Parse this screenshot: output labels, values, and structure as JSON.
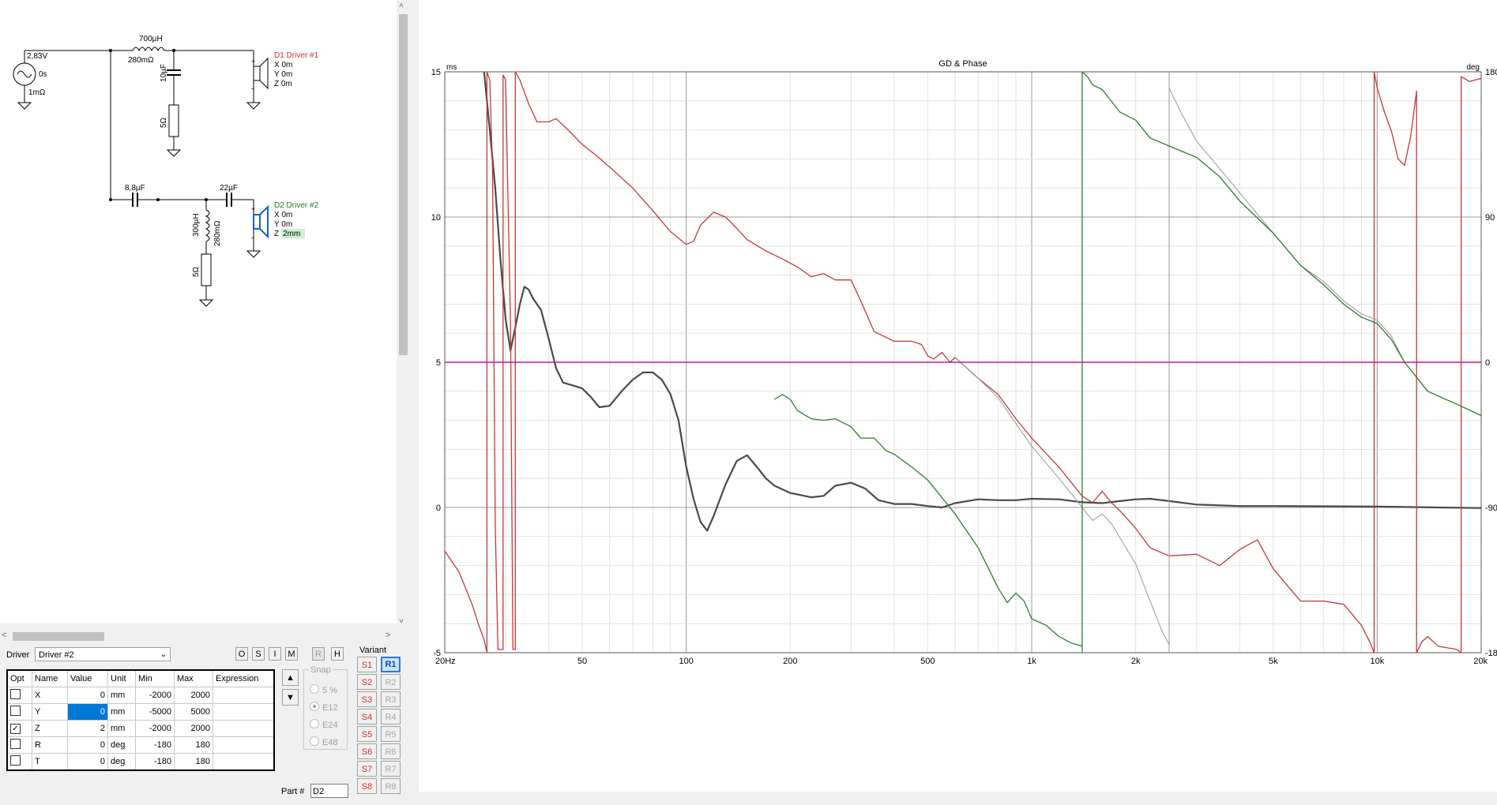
{
  "schematic": {
    "source": {
      "voltage": "2,83V",
      "delay": "0s",
      "resistance": "1mΩ"
    },
    "l1": {
      "value": "700µH",
      "esr": "280mΩ"
    },
    "c1": {
      "value": "10µF"
    },
    "r1": {
      "value": "5Ω"
    },
    "d1": {
      "name": "D1 Driver #1",
      "x": "X 0m",
      "y": "Y 0m",
      "z": "Z 0m"
    },
    "c2": {
      "value": "8,8µF"
    },
    "c3": {
      "value": "22µF"
    },
    "l2": {
      "value": "300µH",
      "esr": "280mΩ"
    },
    "r2": {
      "value": "5Ω"
    },
    "d2": {
      "name": "D2 Driver #2",
      "x": "X 0m",
      "y": "Y 0m",
      "z_prefix": "Z",
      "z_value": "2mm"
    },
    "colors": {
      "d1": "#d32f2f",
      "d2": "#1e7a1e",
      "d2_icon": "#1565c0"
    }
  },
  "scroll": {
    "up": "˄",
    "down": "˅",
    "left": "<",
    "right": ">"
  },
  "driver": {
    "label": "Driver",
    "selected": "Driver #2",
    "chevron": "⌄"
  },
  "toggles": [
    "O",
    "S",
    "I",
    "M",
    "R",
    "H"
  ],
  "table": {
    "headers": [
      "Opt",
      "Name",
      "Value",
      "Unit",
      "Min",
      "Max",
      "Expression"
    ],
    "rows": [
      {
        "opt": "",
        "name": "X",
        "value": "0",
        "unit": "mm",
        "min": "-2000",
        "max": "2000",
        "expr": ""
      },
      {
        "opt": "",
        "name": "Y",
        "value": "0",
        "unit": "mm",
        "min": "-5000",
        "max": "5000",
        "expr": ""
      },
      {
        "opt": "✓",
        "name": "Z",
        "value": "2",
        "unit": "mm",
        "min": "-2000",
        "max": "2000",
        "expr": ""
      },
      {
        "opt": "",
        "name": "R",
        "value": "0",
        "unit": "deg",
        "min": "-180",
        "max": "180",
        "expr": ""
      },
      {
        "opt": "",
        "name": "T",
        "value": "0",
        "unit": "deg",
        "min": "-180",
        "max": "180",
        "expr": ""
      }
    ]
  },
  "updown": {
    "up": "▲",
    "down": "▼"
  },
  "snap": {
    "title": "Snap",
    "options": [
      "5 %",
      "E12",
      "E24",
      "E48"
    ],
    "selected": "E12"
  },
  "part": {
    "label": "Part #",
    "value": "D2"
  },
  "variant": {
    "label": "Variant",
    "s": [
      "S1",
      "S2",
      "S3",
      "S4",
      "S5",
      "S6",
      "S7",
      "S8"
    ],
    "r": [
      "R1",
      "R2",
      "R3",
      "R4",
      "R5",
      "R6",
      "R7",
      "R8"
    ],
    "selected": "R1"
  },
  "chart_data": {
    "type": "line",
    "title": "GD & Phase",
    "ylabel": "ms",
    "y2label": "deg",
    "xscale": "log",
    "xlim": [
      20,
      20000
    ],
    "ylim": [
      -5,
      15
    ],
    "y2lim": [
      -180,
      180
    ],
    "xticks": [
      20,
      50,
      100,
      200,
      500,
      1000,
      2000,
      5000,
      10000,
      20000
    ],
    "xtick_labels": [
      "20Hz",
      "50",
      "100",
      "200",
      "500",
      "1k",
      "2k",
      "5k",
      "10k",
      "20k"
    ],
    "yticks": [
      -5,
      0,
      5,
      10,
      15
    ],
    "ytick_labels": [
      "-5",
      "0",
      "5",
      "10",
      "15"
    ],
    "y2ticks": [
      -180,
      -90,
      0,
      90,
      180
    ],
    "y2tick_labels": [
      "-180",
      "-90",
      "0",
      "90",
      "180"
    ],
    "grid": true,
    "colors": {
      "gd": "#4a4a4a",
      "phase_red": "#c0393b",
      "phase_green": "#2e7d32",
      "phase_gray": "#9e9e9e",
      "zero": "#c2188b"
    },
    "series": [
      {
        "axis": "left",
        "color": "#4a4a4a",
        "width": 2.2,
        "points": [
          [
            26,
            15
          ],
          [
            27,
            13
          ],
          [
            28,
            11
          ],
          [
            29,
            8.5
          ],
          [
            30,
            6.5
          ],
          [
            31,
            5.4
          ],
          [
            32,
            6.2
          ],
          [
            33,
            7.0
          ],
          [
            34,
            7.6
          ],
          [
            35,
            7.5
          ],
          [
            36,
            7.2
          ],
          [
            38,
            6.8
          ],
          [
            40,
            5.8
          ],
          [
            42,
            4.8
          ],
          [
            44,
            4.3
          ],
          [
            47,
            4.2
          ],
          [
            50,
            4.1
          ],
          [
            53,
            3.8
          ],
          [
            56,
            3.45
          ],
          [
            60,
            3.5
          ],
          [
            65,
            4.0
          ],
          [
            70,
            4.4
          ],
          [
            75,
            4.65
          ],
          [
            80,
            4.65
          ],
          [
            85,
            4.4
          ],
          [
            90,
            3.9
          ],
          [
            95,
            3.0
          ],
          [
            100,
            1.4
          ],
          [
            105,
            0.3
          ],
          [
            110,
            -0.5
          ],
          [
            115,
            -0.8
          ],
          [
            120,
            -0.3
          ],
          [
            130,
            0.8
          ],
          [
            140,
            1.6
          ],
          [
            150,
            1.8
          ],
          [
            160,
            1.4
          ],
          [
            170,
            1.0
          ],
          [
            180,
            0.75
          ],
          [
            200,
            0.5
          ],
          [
            230,
            0.35
          ],
          [
            250,
            0.4
          ],
          [
            270,
            0.75
          ],
          [
            300,
            0.85
          ],
          [
            330,
            0.65
          ],
          [
            360,
            0.25
          ],
          [
            400,
            0.12
          ],
          [
            450,
            0.12
          ],
          [
            500,
            0.05
          ],
          [
            550,
            0.0
          ],
          [
            600,
            0.15
          ],
          [
            700,
            0.28
          ],
          [
            800,
            0.25
          ],
          [
            900,
            0.25
          ],
          [
            1000,
            0.3
          ],
          [
            1200,
            0.28
          ],
          [
            1400,
            0.18
          ],
          [
            1600,
            0.15
          ],
          [
            1800,
            0.22
          ],
          [
            2000,
            0.28
          ],
          [
            2200,
            0.3
          ],
          [
            2500,
            0.22
          ],
          [
            3000,
            0.1
          ],
          [
            4000,
            0.05
          ],
          [
            5000,
            0.05
          ],
          [
            7000,
            0.04
          ],
          [
            10000,
            0.03
          ],
          [
            15000,
            0.0
          ],
          [
            20000,
            -0.02
          ]
        ]
      },
      {
        "axis": "right",
        "color": "#c0393b",
        "width": 1.3,
        "points": [
          [
            20,
            -117
          ],
          [
            22,
            -130
          ],
          [
            24,
            -150
          ],
          [
            25,
            -162
          ],
          [
            26,
            -172
          ],
          [
            26.5,
            -180
          ],
          [
            26.5,
            180
          ],
          [
            27,
            175
          ],
          [
            27.5,
            120
          ],
          [
            28,
            -100
          ],
          [
            28.5,
            -178
          ],
          [
            29.5,
            -178
          ],
          [
            29.5,
            178
          ],
          [
            30,
            175
          ],
          [
            31,
            25
          ],
          [
            31.5,
            -178
          ],
          [
            32,
            -178
          ],
          [
            32,
            180
          ],
          [
            33,
            175
          ],
          [
            35,
            160
          ],
          [
            37,
            149
          ],
          [
            40,
            149
          ],
          [
            42,
            151
          ],
          [
            45,
            145
          ],
          [
            50,
            135
          ],
          [
            55,
            128
          ],
          [
            60,
            121
          ],
          [
            70,
            108
          ],
          [
            80,
            94
          ],
          [
            90,
            81
          ],
          [
            100,
            73
          ],
          [
            105,
            75
          ],
          [
            110,
            85
          ],
          [
            120,
            93
          ],
          [
            130,
            90
          ],
          [
            140,
            83
          ],
          [
            150,
            76
          ],
          [
            170,
            69
          ],
          [
            190,
            64
          ],
          [
            210,
            59
          ],
          [
            230,
            53
          ],
          [
            250,
            55
          ],
          [
            270,
            51
          ],
          [
            300,
            51
          ],
          [
            320,
            38
          ],
          [
            350,
            19
          ],
          [
            400,
            13
          ],
          [
            450,
            13
          ],
          [
            480,
            11
          ],
          [
            500,
            4
          ],
          [
            520,
            2
          ],
          [
            550,
            6
          ],
          [
            580,
            0
          ],
          [
            600,
            3
          ],
          [
            700,
            -10
          ],
          [
            800,
            -20
          ],
          [
            900,
            -35
          ],
          [
            1000,
            -47
          ],
          [
            1200,
            -65
          ],
          [
            1400,
            -83
          ],
          [
            1500,
            -87
          ],
          [
            1600,
            -80
          ],
          [
            1700,
            -87
          ],
          [
            1800,
            -92
          ],
          [
            2000,
            -103
          ],
          [
            2200,
            -115
          ],
          [
            2500,
            -120
          ],
          [
            3000,
            -119
          ],
          [
            3500,
            -126
          ],
          [
            4000,
            -116
          ],
          [
            4500,
            -110
          ],
          [
            5000,
            -128
          ],
          [
            6000,
            -148
          ],
          [
            7000,
            -148
          ],
          [
            8000,
            -150
          ],
          [
            9000,
            -163
          ],
          [
            9500,
            -173
          ],
          [
            9800,
            -180
          ],
          [
            9800,
            180
          ],
          [
            10000,
            170
          ],
          [
            10500,
            155
          ],
          [
            11000,
            143
          ],
          [
            11500,
            126
          ],
          [
            12000,
            122
          ],
          [
            12500,
            140
          ],
          [
            13000,
            168
          ],
          [
            13000,
            -180
          ],
          [
            13500,
            -173
          ],
          [
            14000,
            -170
          ],
          [
            15000,
            -176
          ],
          [
            16000,
            -177
          ],
          [
            17000,
            -178
          ],
          [
            17500,
            -180
          ],
          [
            17500,
            177
          ],
          [
            18500,
            174
          ],
          [
            20000,
            176
          ]
        ]
      },
      {
        "axis": "right",
        "color": "#9e9e9e",
        "width": 1.1,
        "points": [
          [
            600,
            3
          ],
          [
            700,
            -10
          ],
          [
            800,
            -22
          ],
          [
            900,
            -38
          ],
          [
            1000,
            -52
          ],
          [
            1200,
            -72
          ],
          [
            1400,
            -90
          ],
          [
            1500,
            -98
          ],
          [
            1600,
            -94
          ],
          [
            1700,
            -100
          ],
          [
            2000,
            -125
          ],
          [
            2200,
            -148
          ],
          [
            2400,
            -168
          ],
          [
            2500,
            -175
          ],
          [
            2500,
            -180
          ],
          [
            2500,
            180
          ],
          [
            2500,
            170
          ],
          [
            2700,
            155
          ],
          [
            3000,
            137
          ],
          [
            3500,
            120
          ],
          [
            4000,
            105
          ],
          [
            5000,
            80
          ],
          [
            6000,
            60
          ],
          [
            7000,
            50
          ],
          [
            8000,
            38
          ],
          [
            9000,
            30
          ],
          [
            10000,
            26
          ],
          [
            11000,
            16
          ],
          [
            12000,
            0
          ],
          [
            14000,
            -18
          ],
          [
            17000,
            -26
          ],
          [
            20000,
            -33
          ]
        ]
      },
      {
        "axis": "right",
        "color": "#2e7d32",
        "width": 1.3,
        "points": [
          [
            180,
            -23
          ],
          [
            190,
            -20
          ],
          [
            200,
            -23
          ],
          [
            210,
            -30
          ],
          [
            230,
            -35
          ],
          [
            250,
            -36
          ],
          [
            270,
            -35
          ],
          [
            300,
            -40
          ],
          [
            320,
            -47
          ],
          [
            350,
            -47
          ],
          [
            380,
            -55
          ],
          [
            400,
            -57
          ],
          [
            450,
            -65
          ],
          [
            500,
            -73
          ],
          [
            600,
            -94
          ],
          [
            700,
            -115
          ],
          [
            800,
            -140
          ],
          [
            850,
            -149
          ],
          [
            900,
            -143
          ],
          [
            950,
            -148
          ],
          [
            1000,
            -159
          ],
          [
            1100,
            -163
          ],
          [
            1200,
            -170
          ],
          [
            1300,
            -174
          ],
          [
            1400,
            -176
          ],
          [
            1400,
            -180
          ],
          [
            1400,
            180
          ],
          [
            1450,
            177
          ],
          [
            1500,
            172
          ],
          [
            1600,
            169
          ],
          [
            1800,
            155
          ],
          [
            2000,
            150
          ],
          [
            2200,
            139
          ],
          [
            2500,
            134
          ],
          [
            3000,
            127
          ],
          [
            3500,
            115
          ],
          [
            4000,
            100
          ],
          [
            5000,
            80
          ],
          [
            6000,
            60
          ],
          [
            7000,
            48
          ],
          [
            8000,
            36
          ],
          [
            9000,
            28
          ],
          [
            10000,
            24
          ],
          [
            11000,
            14
          ],
          [
            12000,
            0
          ],
          [
            14000,
            -18
          ],
          [
            17000,
            -26
          ],
          [
            20000,
            -33
          ]
        ]
      },
      {
        "axis": "left",
        "color": "#c2188b",
        "width": 1.5,
        "points": [
          [
            20,
            5
          ],
          [
            20000,
            5
          ]
        ]
      }
    ]
  }
}
